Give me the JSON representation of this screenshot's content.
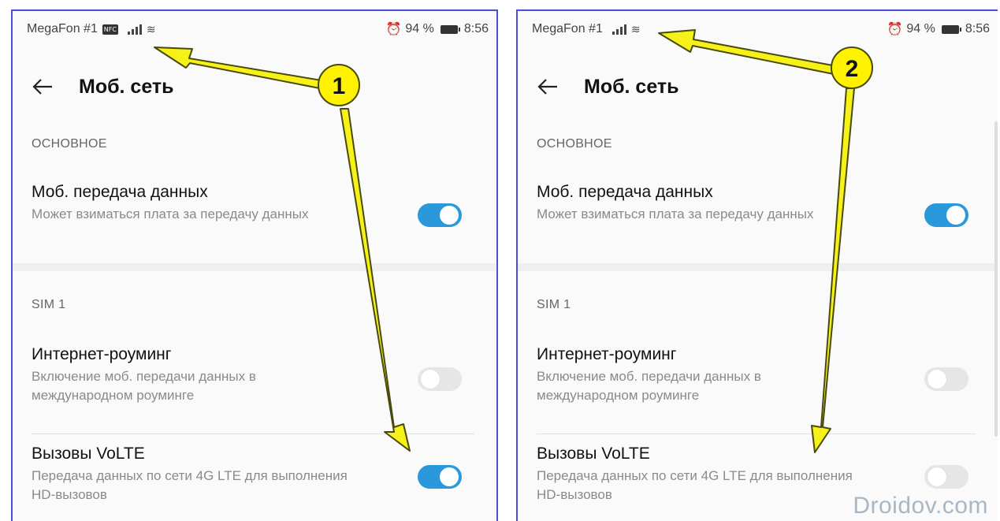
{
  "colors": {
    "panel_border": "#4b4fd8",
    "toggle_on": "#2b98dc",
    "toggle_off": "#e6e6e6",
    "arrow_fill": "#f7f11a",
    "arrow_stroke": "#4a4a10",
    "marker_fill": "#fff200"
  },
  "screens": [
    {
      "status": {
        "carrier": "MegaFon #1",
        "nfc_badge": "NFC",
        "battery": "94 %",
        "time": "8:56"
      },
      "header": {
        "back_icon": "arrow-left-icon",
        "title": "Моб. сеть"
      },
      "sections": [
        {
          "header": "ОСНОВНОЕ"
        },
        {
          "header": "SIM 1"
        }
      ],
      "settings": [
        {
          "title": "Моб. передача данных",
          "desc": "Может взиматься плата за передачу данных",
          "toggle": "on"
        },
        {
          "title": "Интернет-роуминг",
          "desc": "Включение моб. передачи данных в международном роуминге",
          "toggle": "off"
        },
        {
          "title": "Вызовы VoLTE",
          "desc": "Передача данных по сети 4G LTE для выполнения HD-вызовов",
          "toggle": "on"
        }
      ],
      "marker": "1"
    },
    {
      "status": {
        "carrier": "MegaFon #1",
        "battery": "94 %",
        "time": "8:56"
      },
      "header": {
        "back_icon": "arrow-left-icon",
        "title": "Моб. сеть"
      },
      "sections": [
        {
          "header": "ОСНОВНОЕ"
        },
        {
          "header": "SIM 1"
        }
      ],
      "settings": [
        {
          "title": "Моб. передача данных",
          "desc": "Может взиматься плата за передачу данных",
          "toggle": "on"
        },
        {
          "title": "Интернет-роуминг",
          "desc": "Включение моб. передачи данных в международном роуминге",
          "toggle": "off"
        },
        {
          "title": "Вызовы VoLTE",
          "desc": "Передача данных по сети 4G LTE для выполнения HD-вызовов",
          "toggle": "off"
        }
      ],
      "marker": "2",
      "watermark": "Droidov.com"
    }
  ]
}
